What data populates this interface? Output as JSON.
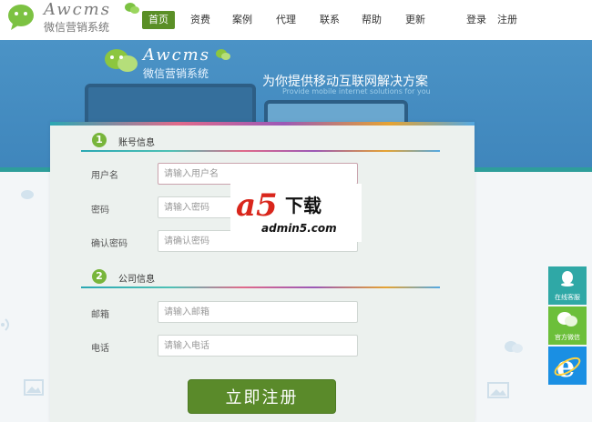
{
  "header": {
    "logo_title": "Awcms",
    "logo_subtitle": "微信营销系统",
    "nav": [
      {
        "label": "首页",
        "active": true
      },
      {
        "label": "资费",
        "active": false
      },
      {
        "label": "案例",
        "active": false
      },
      {
        "label": "代理",
        "active": false
      },
      {
        "label": "联系",
        "active": false
      },
      {
        "label": "帮助",
        "active": false
      },
      {
        "label": "更新",
        "active": false
      }
    ],
    "login": "登录",
    "register": "注册"
  },
  "banner": {
    "logo_title": "Awcms",
    "logo_subtitle": "微信营销系统",
    "slogan": "为你提供移动互联网解决方案",
    "slogan_en": "Provide mobile internet solutions for you"
  },
  "form": {
    "section1": {
      "number": "1",
      "title": "账号信息"
    },
    "section2": {
      "number": "2",
      "title": "公司信息"
    },
    "fields": [
      {
        "label": "用户名",
        "placeholder": "请输入用户名",
        "value": ""
      },
      {
        "label": "密码",
        "placeholder": "请输入密码",
        "value": ""
      },
      {
        "label": "确认密码",
        "placeholder": "请确认密码",
        "value": ""
      },
      {
        "label": "邮箱",
        "placeholder": "请输入邮箱",
        "value": ""
      },
      {
        "label": "电话",
        "placeholder": "请输入电话",
        "value": ""
      }
    ],
    "submit": "立即注册"
  },
  "watermark": {
    "letter": "a5",
    "title": "下载",
    "domain": "admin5.com"
  },
  "side_buttons": [
    {
      "label": "在线客服",
      "icon": "qq-icon",
      "color": "#2fa8a6"
    },
    {
      "label": "官方微信",
      "icon": "wechat-icon",
      "color": "#6cbf3a"
    },
    {
      "label": "",
      "icon": "ie-icon",
      "color": "#1a8fe3"
    }
  ],
  "colors": {
    "brand_green": "#5a8f26",
    "banner_blue": "#4b93c6",
    "teal": "#2e9e9b"
  }
}
